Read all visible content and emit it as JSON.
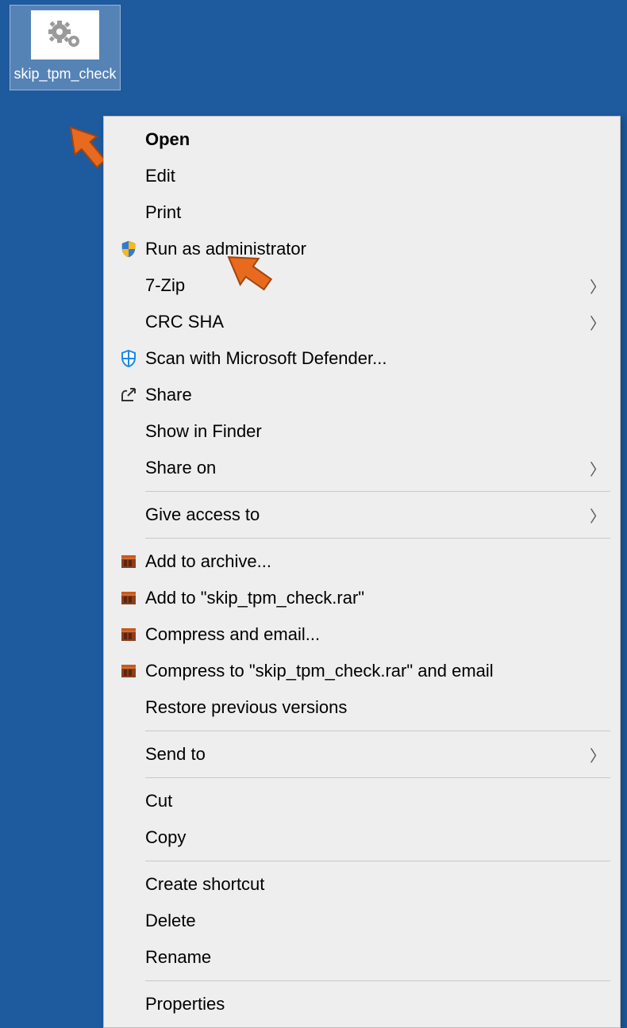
{
  "desktop": {
    "icon_label": "skip_tpm_check"
  },
  "menu": {
    "open": "Open",
    "edit": "Edit",
    "print": "Print",
    "run_as_admin": "Run as administrator",
    "seven_zip": "7-Zip",
    "crc_sha": "CRC SHA",
    "defender": "Scan with Microsoft Defender...",
    "share": "Share",
    "show_in_finder": "Show in Finder",
    "share_on": "Share on",
    "give_access": "Give access to",
    "add_archive": "Add to archive...",
    "add_to_rar": "Add to \"skip_tpm_check.rar\"",
    "compress_email": "Compress and email...",
    "compress_to_rar_email": "Compress to \"skip_tpm_check.rar\" and email",
    "restore": "Restore previous versions",
    "send_to": "Send to",
    "cut": "Cut",
    "copy": "Copy",
    "create_shortcut": "Create shortcut",
    "delete": "Delete",
    "rename": "Rename",
    "properties": "Properties"
  }
}
